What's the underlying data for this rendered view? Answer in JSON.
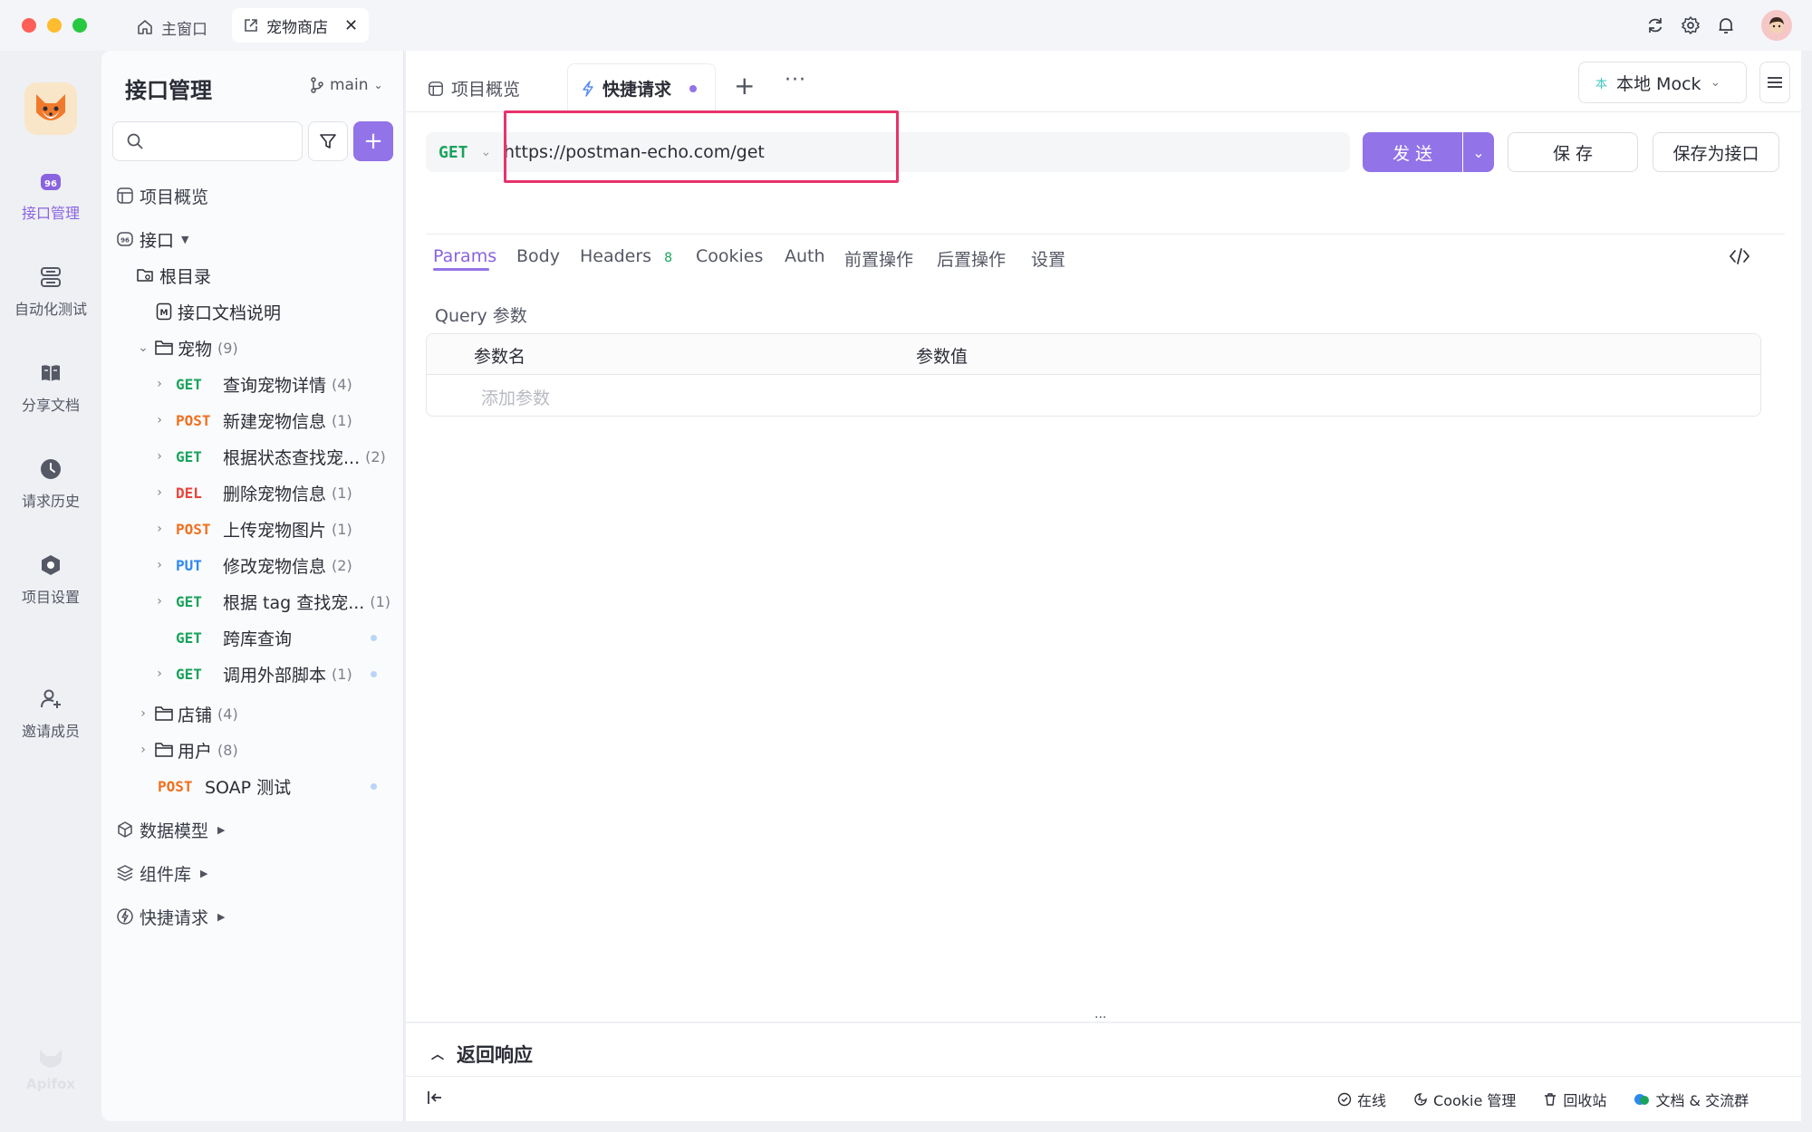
{
  "titlebar": {
    "tab_home": "主窗口",
    "tab_project": "宠物商店"
  },
  "rail": {
    "items": [
      {
        "label": "接口管理",
        "icon": "api-icon"
      },
      {
        "label": "自动化测试",
        "icon": "automation-icon"
      },
      {
        "label": "分享文档",
        "icon": "book-icon"
      },
      {
        "label": "请求历史",
        "icon": "clock-icon"
      },
      {
        "label": "项目设置",
        "icon": "settings-hex-icon"
      },
      {
        "label": "邀请成员",
        "icon": "add-user-icon"
      }
    ],
    "logo_text": "Apifox"
  },
  "sidebar": {
    "title": "接口管理",
    "branch": "main",
    "overview": "项目概览",
    "api_root": "接口",
    "root_dir": "根目录",
    "doc_item": "接口文档说明",
    "pets_folder": {
      "label": "宠物",
      "count": "(9)"
    },
    "pets_items": [
      {
        "method": "GET",
        "label": "查询宠物详情",
        "count": "(4)"
      },
      {
        "method": "POST",
        "label": "新建宠物信息",
        "count": "(1)"
      },
      {
        "method": "GET",
        "label": "根据状态查找宠...",
        "count": "(2)"
      },
      {
        "method": "DEL",
        "label": "删除宠物信息",
        "count": "(1)"
      },
      {
        "method": "POST",
        "label": "上传宠物图片",
        "count": "(1)"
      },
      {
        "method": "PUT",
        "label": "修改宠物信息",
        "count": "(2)"
      },
      {
        "method": "GET",
        "label": "根据 tag 查找宠...",
        "count": "(1)"
      },
      {
        "method": "GET",
        "label": "跨库查询",
        "count": ""
      },
      {
        "method": "GET",
        "label": "调用外部脚本",
        "count": "(1)"
      }
    ],
    "shop_folder": {
      "label": "店铺",
      "count": "(4)"
    },
    "user_folder": {
      "label": "用户",
      "count": "(8)"
    },
    "soap_item": {
      "method": "POST",
      "label": "SOAP 测试"
    },
    "data_models": "数据模型",
    "components": "组件库",
    "quick_requests": "快捷请求"
  },
  "tabs": {
    "overview": "项目概览",
    "quick": "快捷请求",
    "env": "本地 Mock",
    "env_badge": "本"
  },
  "request": {
    "method": "GET",
    "url": "https://postman-echo.com/get",
    "send": "发 送",
    "save": "保 存",
    "save_as": "保存为接口"
  },
  "param_tabs": {
    "params": "Params",
    "body": "Body",
    "headers": "Headers",
    "headers_count": "8",
    "cookies": "Cookies",
    "auth": "Auth",
    "pre": "前置操作",
    "post": "后置操作",
    "settings": "设置"
  },
  "query": {
    "title": "Query 参数",
    "col_name": "参数名",
    "col_value": "参数值",
    "add_placeholder": "添加参数"
  },
  "response": {
    "title": "返回响应"
  },
  "statusbar": {
    "online": "在线",
    "cookie": "Cookie 管理",
    "trash": "回收站",
    "docs": "文档 & 交流群"
  },
  "colors": {
    "accent": "#9373e8",
    "get": "#1aa35d",
    "post": "#f0701f",
    "del": "#e8453c",
    "put": "#2f88f0",
    "highlight": "#e8336b"
  }
}
